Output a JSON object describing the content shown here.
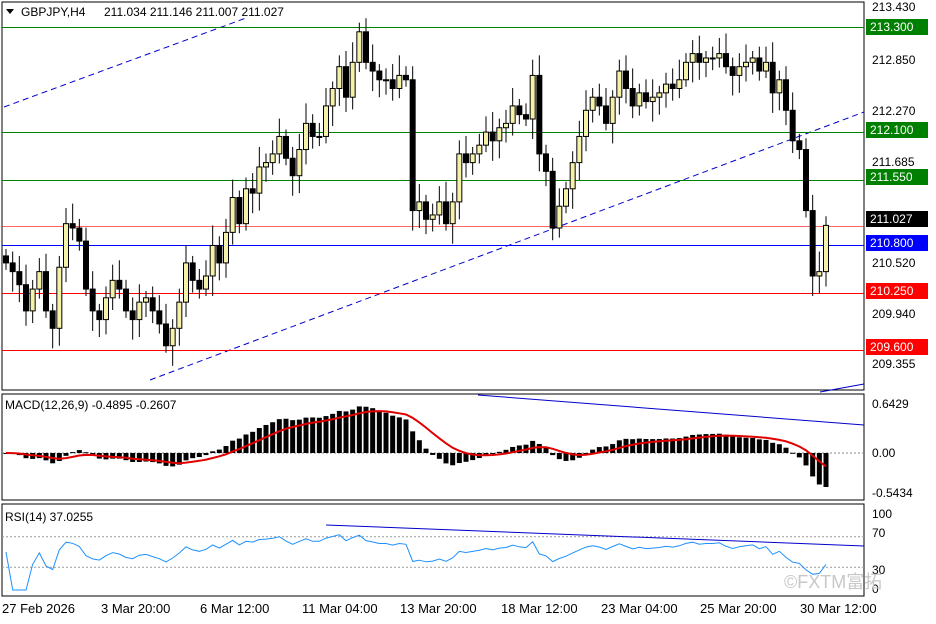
{
  "header": {
    "symbol": "GBPJPY,H4",
    "ohlc": "211.034 211.146 211.007 211.027"
  },
  "price_axis": {
    "labels": [
      "213.430",
      "212.850",
      "212.270",
      "211.685",
      "210.520",
      "209.940",
      "209.355"
    ]
  },
  "levels": [
    {
      "value": 213.3,
      "label": "213.300",
      "color": "#008000"
    },
    {
      "value": 212.1,
      "label": "212.100",
      "color": "#008000"
    },
    {
      "value": 211.55,
      "label": "211.550",
      "color": "#008000"
    },
    {
      "value": 211.027,
      "label": "211.027",
      "color": "#000000",
      "kind": "current"
    },
    {
      "value": 210.8,
      "label": "210.800",
      "color": "#0000ff"
    },
    {
      "value": 210.25,
      "label": "210.250",
      "color": "#ff0000"
    },
    {
      "value": 209.6,
      "label": "209.600",
      "color": "#ff0000"
    }
  ],
  "macd": {
    "title": "MACD(12,26,9) -0.4895 -0.2607",
    "axis_labels": [
      "0.6429",
      "0.00",
      "-0.5434"
    ]
  },
  "rsi": {
    "title": "RSI(14) 37.0255",
    "axis_labels": [
      "100",
      "70",
      "30",
      "0"
    ]
  },
  "time_axis": {
    "labels": [
      "27 Feb 2026",
      "3 Mar 20:00",
      "6 Mar 12:00",
      "11 Mar 04:00",
      "13 Mar 20:00",
      "18 Mar 12:00",
      "23 Mar 04:00",
      "25 Mar 20:00",
      "30 Mar 12:00"
    ]
  },
  "watermark": "©FXTM富拓",
  "colors": {
    "bull": "#f4f1a8",
    "bear": "#000000",
    "macd_signal": "#e00000",
    "rsi_line": "#1e90ff",
    "trend_line": "#0000cc"
  },
  "chart_data": {
    "type": "candlestick",
    "symbol": "GBPJPY",
    "timeframe": "H4",
    "y_range": [
      209.2,
      213.5
    ],
    "close_series": [
      210.6,
      210.5,
      210.35,
      210.05,
      210.3,
      210.5,
      210.05,
      209.85,
      210.55,
      211.05,
      211.0,
      210.85,
      210.3,
      210.05,
      209.95,
      210.2,
      210.4,
      210.3,
      210.05,
      209.95,
      210.15,
      210.2,
      210.05,
      209.9,
      209.65,
      209.85,
      210.15,
      210.6,
      210.4,
      210.3,
      210.45,
      210.8,
      210.6,
      210.95,
      211.35,
      211.05,
      211.45,
      211.4,
      211.7,
      211.75,
      211.85,
      212.05,
      211.8,
      211.6,
      211.9,
      212.2,
      212.05,
      212.05,
      212.4,
      212.6,
      212.85,
      212.5,
      212.9,
      213.25,
      212.9,
      212.8,
      212.7,
      212.7,
      212.6,
      212.75,
      212.7,
      211.2,
      211.3,
      211.1,
      211.15,
      211.3,
      211.05,
      211.3,
      211.85,
      211.75,
      211.85,
      211.95,
      212.1,
      212.0,
      212.15,
      212.2,
      212.4,
      212.3,
      212.25,
      212.75,
      211.85,
      211.65,
      211.0,
      211.25,
      211.45,
      211.75,
      212.05,
      212.35,
      212.5,
      212.4,
      212.2,
      212.5,
      212.8,
      212.6,
      212.4,
      212.55,
      212.45,
      212.5,
      212.55,
      212.65,
      212.6,
      212.7,
      212.9,
      213.0,
      212.9,
      212.95,
      212.95,
      213.0,
      212.85,
      212.75,
      212.85,
      212.9,
      212.95,
      212.8,
      212.9,
      212.55,
      212.7,
      212.35,
      212.0,
      211.9,
      211.2,
      210.45,
      210.5,
      211.03
    ]
  }
}
